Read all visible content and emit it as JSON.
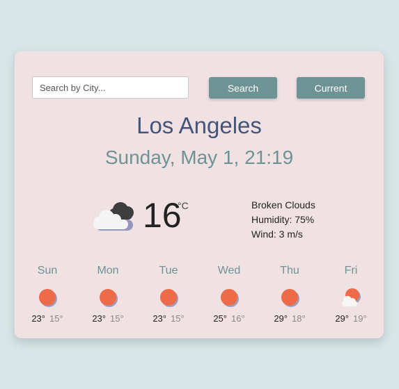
{
  "search": {
    "placeholder": "Search by City...",
    "value": "",
    "search_label": "Search",
    "current_label": "Current"
  },
  "location": {
    "city": "Los Angeles",
    "datetime": "Sunday, May 1, 21:19"
  },
  "current": {
    "icon": "broken-clouds-icon",
    "temperature": "16",
    "unit": "°C",
    "description": "Broken Clouds",
    "humidity": "Humidity: 75%",
    "wind": "Wind: 3 m/s"
  },
  "forecast": [
    {
      "day": "Sun",
      "icon": "sun-icon",
      "max": "23°",
      "min": "15°"
    },
    {
      "day": "Mon",
      "icon": "sun-icon",
      "max": "23°",
      "min": "15°"
    },
    {
      "day": "Tue",
      "icon": "sun-icon",
      "max": "23°",
      "min": "15°"
    },
    {
      "day": "Wed",
      "icon": "sun-icon",
      "max": "25°",
      "min": "16°"
    },
    {
      "day": "Thu",
      "icon": "sun-icon",
      "max": "29°",
      "min": "18°"
    },
    {
      "day": "Fri",
      "icon": "partly-cloudy-icon",
      "max": "29°",
      "min": "19°"
    }
  ],
  "colors": {
    "background": "#d9e6e7",
    "card": "#f0e2e3",
    "accent": "#6e9394",
    "city": "#44557a",
    "sun": "#ee6b4a"
  }
}
